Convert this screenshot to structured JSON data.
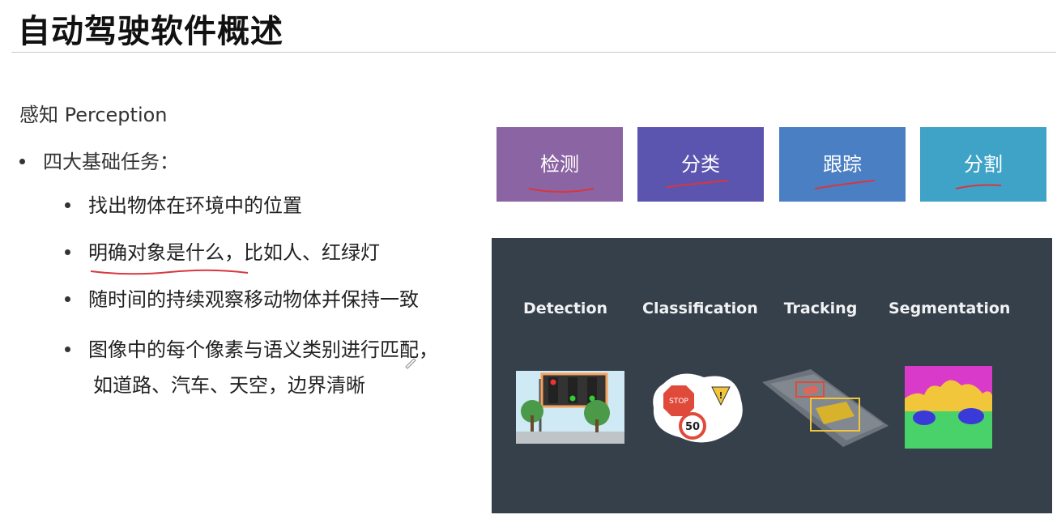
{
  "title": "自动驾驶软件概述",
  "section": "感知 Perception",
  "bullet": "四大基础任务：",
  "subs": [
    "找出物体在环境中的位置",
    "明确对象是什么，比如人、红绿灯",
    "随时间的持续观察移动物体并保持一致",
    "图像中的每个像素与语义类别进行匹配，",
    "如道路、汽车、天空，边界清晰"
  ],
  "tiles": [
    {
      "label": "检测",
      "color": "#8b65a3"
    },
    {
      "label": "分类",
      "color": "#5b55b0"
    },
    {
      "label": "跟踪",
      "color": "#4a7fc4"
    },
    {
      "label": "分割",
      "color": "#3fa3c8"
    }
  ],
  "panel": {
    "labels": [
      "Detection",
      "Classification",
      "Tracking",
      "Segmentation"
    ],
    "stop_text": "STOP",
    "speed_text": "50"
  }
}
